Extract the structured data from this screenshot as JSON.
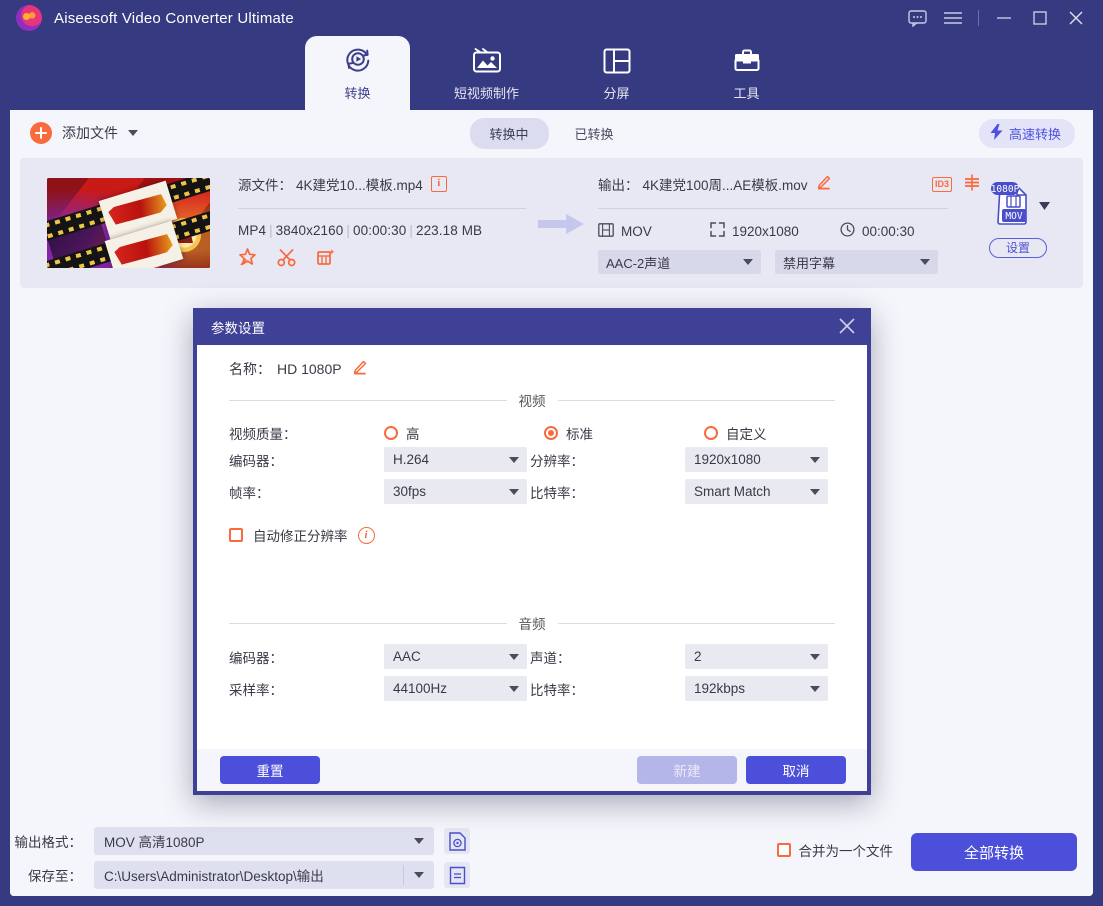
{
  "window": {
    "app_title": "Aiseesoft Video Converter Ultimate",
    "controls": {
      "feedback": "feedback-icon",
      "menu": "hamburger-icon",
      "minimize": "minimize-icon",
      "maximize": "maximize-icon",
      "close": "close-icon"
    }
  },
  "nav": {
    "tabs": [
      {
        "label": "转换",
        "icon": "convert-icon",
        "active": true
      },
      {
        "label": "短视频制作",
        "icon": "video-maker-icon",
        "active": false
      },
      {
        "label": "分屏",
        "icon": "split-screen-icon",
        "active": false
      },
      {
        "label": "工具",
        "icon": "toolbox-icon",
        "active": false
      }
    ]
  },
  "toolbar": {
    "add_file_label": "添加文件",
    "segments": [
      {
        "label": "转换中",
        "active": true
      },
      {
        "label": "已转换",
        "active": false
      }
    ],
    "high_speed_label": "高速转换"
  },
  "file_card": {
    "source": {
      "prefix": "源文件：",
      "filename": "4K建党10...模板.mp4",
      "format": "MP4",
      "resolution": "3840x2160",
      "duration": "00:00:30",
      "size": "223.18 MB",
      "actions": [
        "enhance-icon",
        "trim-icon",
        "effects-icon"
      ]
    },
    "output": {
      "prefix": "输出：",
      "filename": "4K建党100周...AE模板.mov",
      "id3_label": "ID3",
      "format": "MOV",
      "resolution": "1920x1080",
      "duration": "00:00:30",
      "audio_track": "AAC-2声道",
      "subtitle_track": "禁用字幕"
    },
    "format_badge": {
      "quality": "1080P",
      "container": "MOV",
      "settings_label": "设置"
    }
  },
  "modal": {
    "title": "参数设置",
    "name_label": "名称：",
    "name_value": "HD 1080P",
    "video_section": "视频",
    "audio_section": "音频",
    "video": {
      "quality_label": "视频质量：",
      "quality_options": [
        {
          "label": "高",
          "selected": false
        },
        {
          "label": "标准",
          "selected": true
        },
        {
          "label": "自定义",
          "selected": false
        }
      ],
      "encoder_label": "编码器：",
      "encoder_value": "H.264",
      "resolution_label": "分辨率：",
      "resolution_value": "1920x1080",
      "framerate_label": "帧率：",
      "framerate_value": "30fps",
      "bitrate_label": "比特率：",
      "bitrate_value": "Smart Match",
      "auto_fix_label": "自动修正分辨率",
      "auto_fix_checked": false
    },
    "audio": {
      "encoder_label": "编码器：",
      "encoder_value": "AAC",
      "channel_label": "声道：",
      "channel_value": "2",
      "samplerate_label": "采样率：",
      "samplerate_value": "44100Hz",
      "bitrate_label": "比特率：",
      "bitrate_value": "192kbps"
    },
    "buttons": {
      "reset": "重置",
      "create": "新建",
      "cancel": "取消"
    }
  },
  "bottom": {
    "output_format_label": "输出格式：",
    "output_format_value": "MOV 高清1080P",
    "save_to_label": "保存至：",
    "save_to_value": "C:\\Users\\Administrator\\Desktop\\输出",
    "merge_label": "合并为一个文件",
    "merge_checked": false,
    "convert_all_label": "全部转换"
  },
  "colors": {
    "header_purple": "#383a7e",
    "accent_blue": "#4b4fd9",
    "accent_orange": "#f96a3c",
    "panel_bg": "#f5f6fb",
    "card_bg": "#e7e8f3",
    "modal_border": "#3f4196"
  }
}
